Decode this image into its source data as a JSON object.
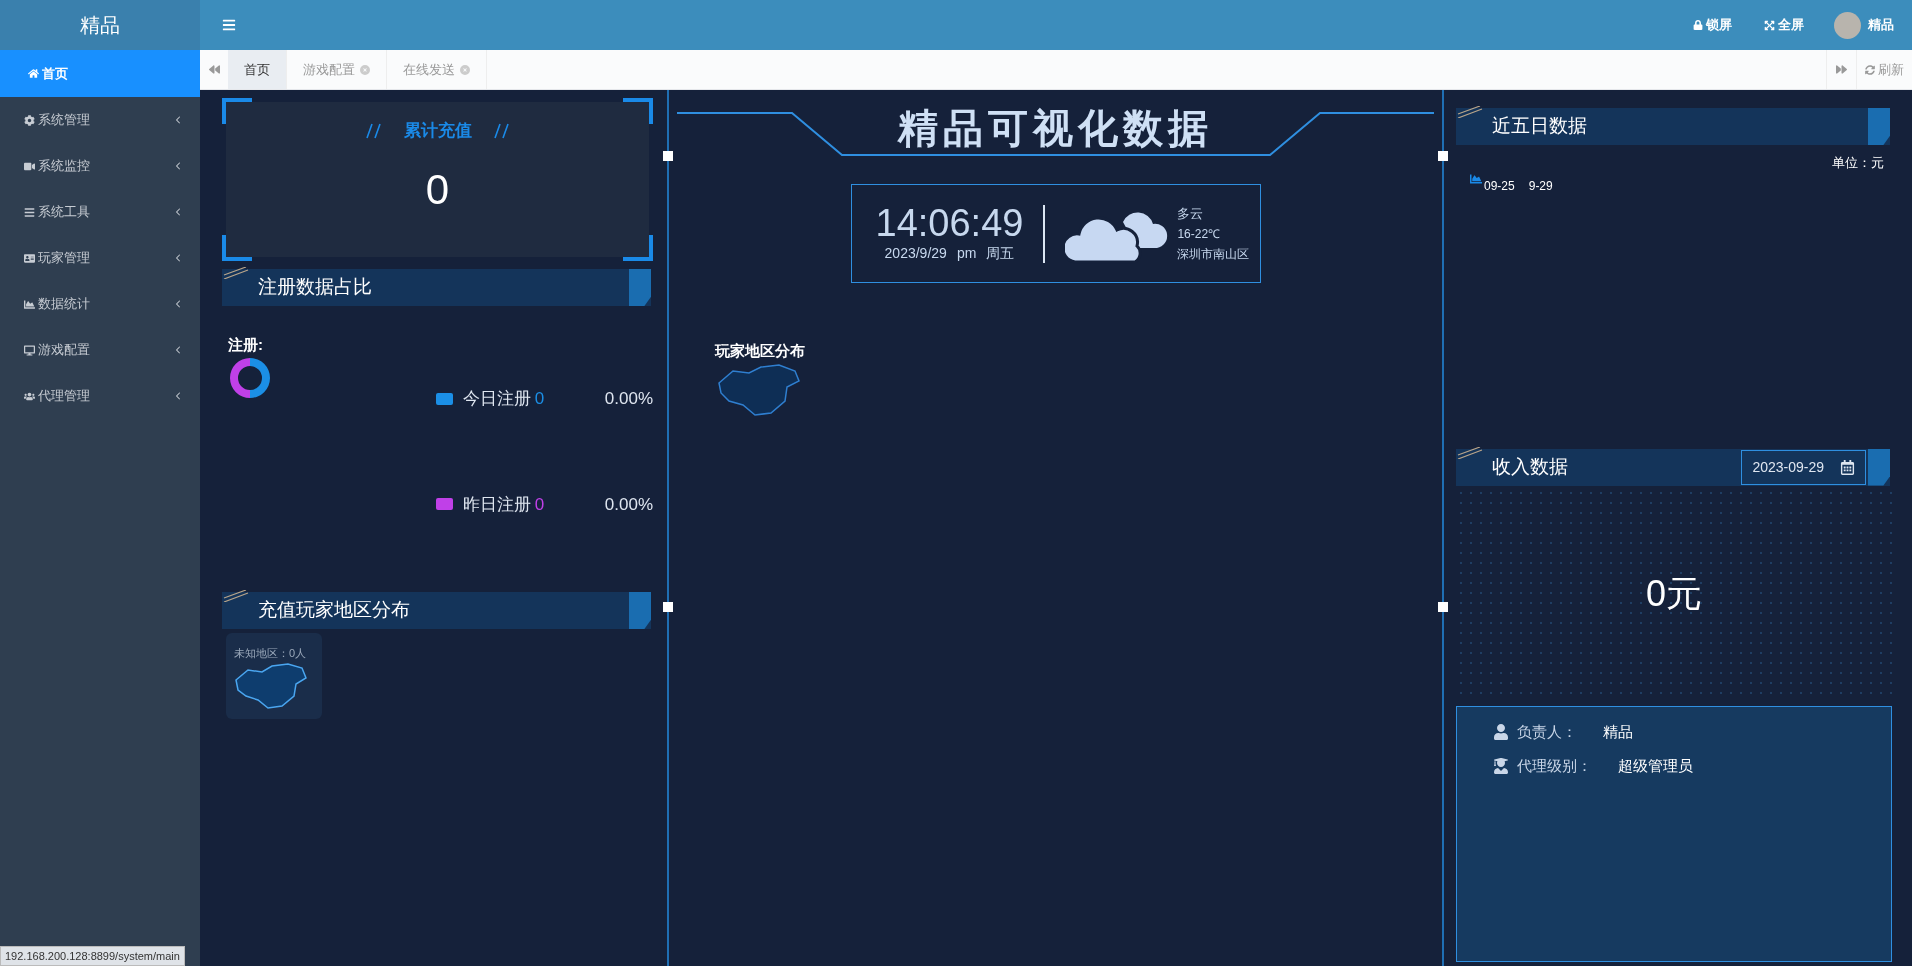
{
  "sidebar": {
    "title": "精品",
    "items": [
      {
        "label": "首页",
        "selected": true
      },
      {
        "label": "系统管理",
        "selected": false
      },
      {
        "label": "系统监控",
        "selected": false
      },
      {
        "label": "系统工具",
        "selected": false
      },
      {
        "label": "玩家管理",
        "selected": false
      },
      {
        "label": "数据统计",
        "selected": false
      },
      {
        "label": "游戏配置",
        "selected": false
      },
      {
        "label": "代理管理",
        "selected": false
      }
    ]
  },
  "topbar": {
    "lock": "锁屏",
    "fullscreen": "全屏",
    "user": "精品"
  },
  "tabs": [
    {
      "label": "首页",
      "selected": true,
      "closable": false
    },
    {
      "label": "游戏配置",
      "selected": false,
      "closable": true
    },
    {
      "label": "在线发送",
      "selected": false,
      "closable": true
    }
  ],
  "refresh": "刷新",
  "total_recharge": {
    "title": "累计充值",
    "value": "0"
  },
  "register": {
    "title": "注册数据占比",
    "chart_label": "注册:",
    "legend": [
      {
        "label": "今日注册",
        "value": "0",
        "percent": "0.00%",
        "color": "#1b8fe6"
      },
      {
        "label": "昨日注册",
        "value": "0",
        "percent": "0.00%",
        "color": "#c040e8"
      }
    ]
  },
  "recharge_region": {
    "title": "充值玩家地区分布",
    "map_label": "未知地区：0人"
  },
  "center": {
    "title": "精品可视化数据",
    "time": "14:06:49",
    "date": "2023/9/29",
    "ampm": "pm",
    "weekday": "周五",
    "weather": "多云",
    "temp": "16-22℃",
    "location": "深圳市南山区",
    "map_title": "玩家地区分布"
  },
  "five_days": {
    "title": "近五日数据",
    "unit": "单位：元",
    "dates": [
      "09-25",
      "9-29"
    ]
  },
  "income": {
    "title": "收入数据",
    "date": "2023-09-29",
    "value": "0元"
  },
  "info": [
    {
      "label": "负责人：",
      "value": "精品"
    },
    {
      "label": "代理级别：",
      "value": "超级管理员"
    }
  ],
  "status_url": "192.168.200.128:8899/system/main"
}
